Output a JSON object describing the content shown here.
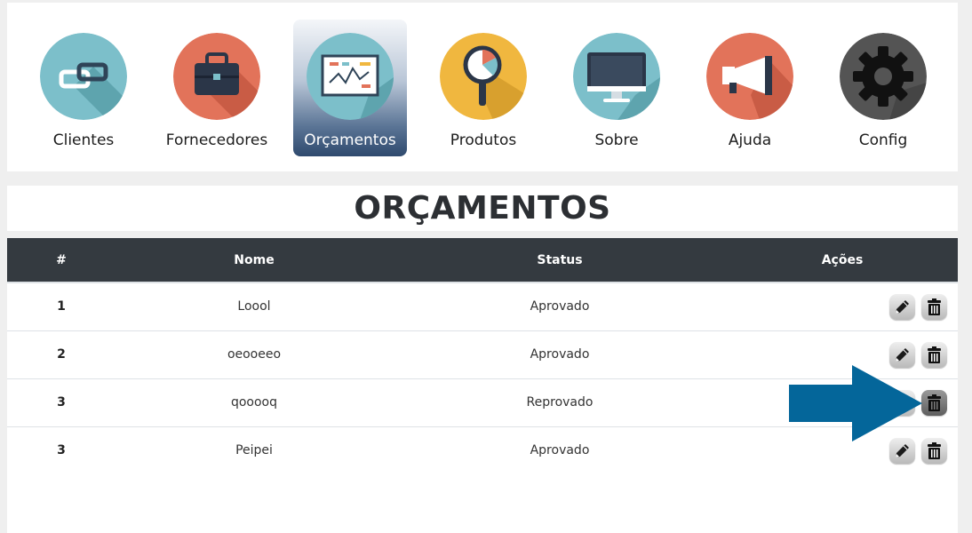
{
  "nav": {
    "items": [
      {
        "label": "Clientes",
        "icon": "link-chain-icon",
        "color": "#7cbfca"
      },
      {
        "label": "Fornecedores",
        "icon": "briefcase-icon",
        "color": "#e2735a"
      },
      {
        "label": "Orçamentos",
        "icon": "presentation-chart-icon",
        "color": "#7cbfca",
        "active": true
      },
      {
        "label": "Produtos",
        "icon": "magnifier-icon",
        "color": "#f0b73f"
      },
      {
        "label": "Sobre",
        "icon": "monitor-icon",
        "color": "#7cbfca"
      },
      {
        "label": "Ajuda",
        "icon": "megaphone-icon",
        "color": "#e2735a"
      },
      {
        "label": "Config",
        "icon": "gear-icon",
        "color": "#545454"
      }
    ]
  },
  "page": {
    "title": "ORÇAMENTOS"
  },
  "table": {
    "headers": [
      "#",
      "Nome",
      "Status",
      "Ações"
    ],
    "rows": [
      {
        "num": "1",
        "nome": "Loool",
        "status": "Aprovado"
      },
      {
        "num": "2",
        "nome": "oeooeeo",
        "status": "Aprovado"
      },
      {
        "num": "3",
        "nome": "qooooq",
        "status": "Reprovado"
      },
      {
        "num": "3",
        "nome": "Peipei",
        "status": "Aprovado"
      }
    ]
  },
  "colors": {
    "header_bg": "#343a40",
    "arrow": "#04669a",
    "active_nav": "#2f4a6e"
  }
}
